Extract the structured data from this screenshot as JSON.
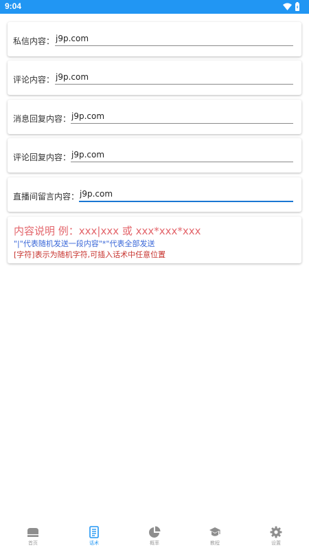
{
  "status_bar": {
    "time": "9:04",
    "color": "#2196F3",
    "icons": [
      "wifi-icon",
      "battery-icon"
    ]
  },
  "fields": [
    {
      "label": "私信内容：",
      "value": "j9p.com"
    },
    {
      "label": "评论内容：",
      "value": "j9p.com"
    },
    {
      "label": "消息回复内容：",
      "value": "j9p.com"
    },
    {
      "label": "评论回复内容：",
      "value": "j9p.com"
    },
    {
      "label": "直播间留言内容：",
      "value": "j9p.com",
      "focused": true
    }
  ],
  "description": {
    "title": "内容说明 例：xxx|xxx 或 xxx*xxx*xxx",
    "line1": "\"|\"代表随机发送一段内容\"*\"代表全部发送",
    "line2": "[字符]表示为随机字符,可插入话术中任意位置",
    "colors": {
      "title": "#e3656b",
      "line1": "#3967d8",
      "line2": "#c7332e"
    }
  },
  "bottom_nav": {
    "active_index": 1,
    "active_color": "#2196F3",
    "items": [
      {
        "label": "首页",
        "icon": "home-icon"
      },
      {
        "label": "话术",
        "icon": "document-icon"
      },
      {
        "label": "概率",
        "icon": "pie-chart-icon"
      },
      {
        "label": "教程",
        "icon": "graduation-cap-icon"
      },
      {
        "label": "设置",
        "icon": "gear-icon"
      }
    ]
  }
}
